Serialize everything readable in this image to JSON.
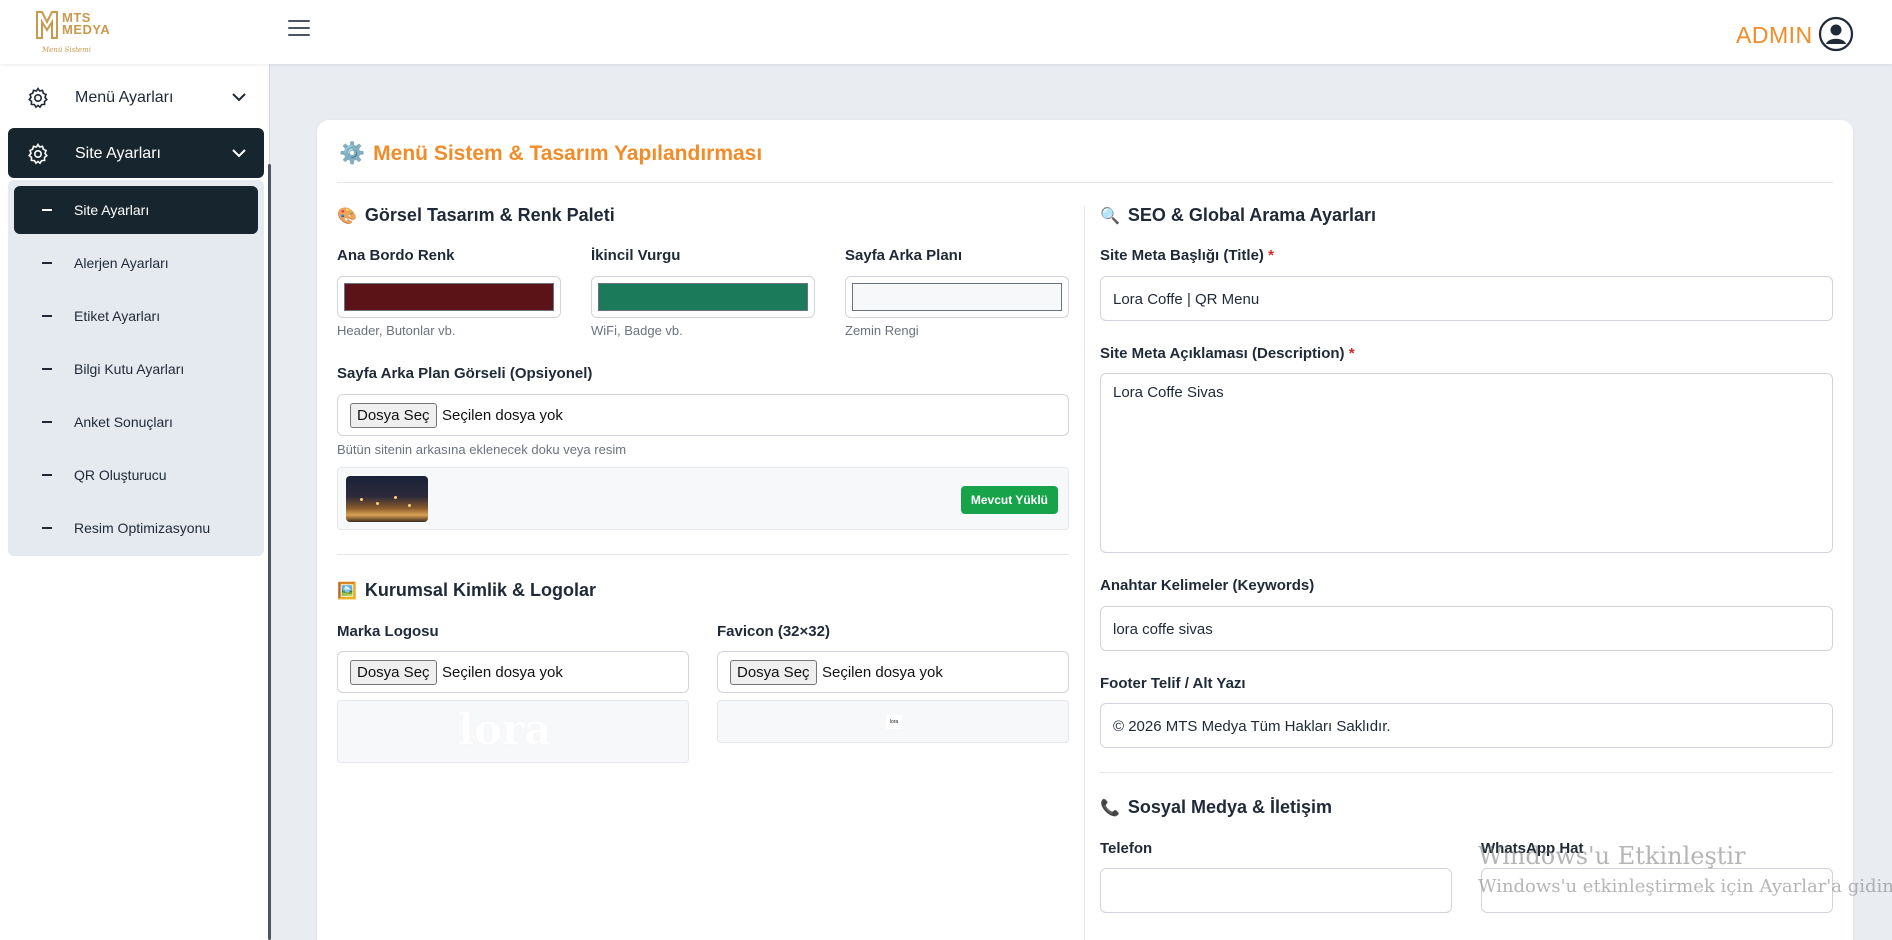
{
  "header": {
    "logo_text_1": "MTS",
    "logo_text_2": "MEDYA",
    "logo_sub": "Menü Sistemi",
    "admin_label": "ADMIN"
  },
  "sidebar": {
    "items": [
      {
        "label": "Menü Ayarları"
      },
      {
        "label": "Site Ayarları"
      }
    ],
    "submenu": [
      {
        "label": "Site Ayarları"
      },
      {
        "label": "Alerjen Ayarları"
      },
      {
        "label": "Etiket Ayarları"
      },
      {
        "label": "Bilgi Kutu Ayarları"
      },
      {
        "label": "Anket Sonuçları"
      },
      {
        "label": "QR Oluşturucu"
      },
      {
        "label": "Resim Optimizasyonu"
      }
    ]
  },
  "main": {
    "title_emoji": "⚙️",
    "title": "Menü Sistem & Tasarım Yapılandırması",
    "design": {
      "emoji": "🎨",
      "title": "Görsel Tasarım & Renk Paleti",
      "colors": [
        {
          "label": "Ana Bordo Renk",
          "value": "#5c1318",
          "hint": "Header, Butonlar vb."
        },
        {
          "label": "İkincil Vurgu",
          "value": "#1b7a5a",
          "hint": "WiFi, Badge vb."
        },
        {
          "label": "Sayfa Arka Planı",
          "value": "#f7f8fa",
          "hint": "Zemin Rengi"
        }
      ],
      "bg_image_label": "Sayfa Arka Plan Görseli (Opsiyonel)",
      "file_button": "Dosya Seç",
      "file_none": "Seçilen dosya yok",
      "bg_image_hint": "Bütün sitenin arkasına eklenecek doku veya resim",
      "bg_badge": "Mevcut Yüklü"
    },
    "identity": {
      "emoji": "🖼️",
      "title": "Kurumsal Kimlik & Logolar",
      "logo_label": "Marka Logosu",
      "favicon_label": "Favicon (32×32)",
      "logo_preview_text": "lora",
      "favicon_preview_text": "lora"
    },
    "seo": {
      "emoji": "🔍",
      "title": "SEO & Global Arama Ayarları",
      "meta_title_label": "Site Meta Başlığı (Title)",
      "meta_title_value": "Lora Coffe | QR Menu",
      "meta_desc_label": "Site Meta Açıklaması (Description)",
      "meta_desc_value": "Lora Coffe  Sivas",
      "keywords_label": "Anahtar Kelimeler (Keywords)",
      "keywords_value": "lora coffe sivas",
      "footer_label": "Footer Telif / Alt Yazı",
      "footer_value": "© 2026 MTS Medya Tüm Hakları Saklıdır.",
      "required_mark": "*"
    },
    "social": {
      "emoji": "📞",
      "title": "Sosyal Medya & İletişim",
      "phone_label": "Telefon",
      "whatsapp_label": "WhatsApp Hat",
      "phone_value": "",
      "whatsapp_value": ""
    }
  },
  "watermark": {
    "line1": "Windows'u Etkinleştir",
    "line2": "Windows'u etkinleştirmek için Ayarlar'a gidin."
  }
}
